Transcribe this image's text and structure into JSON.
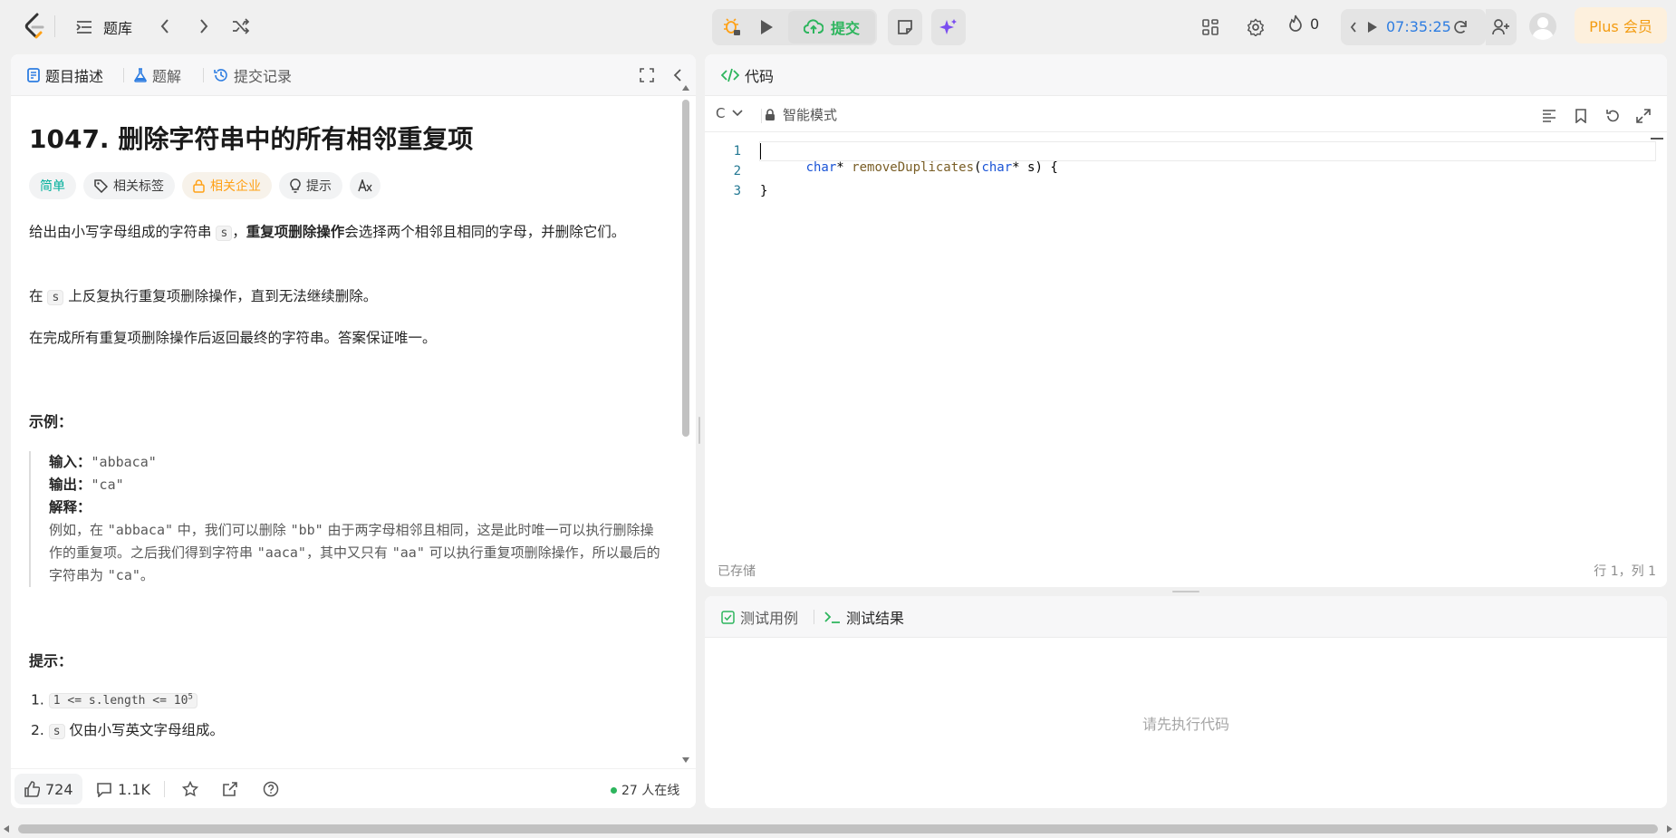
{
  "topbar": {
    "problem_list_label": "题库",
    "submit_label": "提交",
    "streak_count": "0",
    "timer": "07:35:25",
    "plus_label": "Plus 会员"
  },
  "left_panel": {
    "tabs": [
      "题目描述",
      "题解",
      "提交记录"
    ],
    "title": "1047. 删除字符串中的所有相邻重复项",
    "tags": {
      "difficulty": "简单",
      "related_tags": "相关标签",
      "related_companies": "相关企业",
      "hint": "提示"
    },
    "description": {
      "p1_part1": "给出由小写字母组成的字符串 ",
      "p1_code": "s",
      "p1_part2": "，",
      "p1_bold": "重复项删除操作",
      "p1_part3": "会选择两个相邻且相同的字母，并删除它们。",
      "p2_part1": "在 ",
      "p2_code": "s",
      "p2_part2": " 上反复执行重复项删除操作，直到无法继续删除。",
      "p3": "在完成所有重复项删除操作后返回最终的字符串。答案保证唯一。"
    },
    "example": {
      "heading": "示例：",
      "input_label": "输入：",
      "input_value": "\"abbaca\"",
      "output_label": "输出：",
      "output_value": "\"ca\"",
      "explain_label": "解释：",
      "explain_1": "例如，在 ",
      "explain_q1": "\"abbaca\"",
      "explain_2": " 中，我们可以删除 ",
      "explain_q2": "\"bb\"",
      "explain_3": " 由于两字母相邻且相同，这是此时唯一可以执行删除操作的重复项。之后我们得到字符串 ",
      "explain_q3": "\"aaca\"",
      "explain_4": "，其中又只有 ",
      "explain_q4": "\"aa\"",
      "explain_5": " 可以执行重复项删除操作，所以最后的字符串为 ",
      "explain_q5": "\"ca\"",
      "explain_6": "。"
    },
    "hints": {
      "heading": "提示：",
      "item1_num": "1.",
      "item1_code": "1 <= s.length <= 10",
      "item1_sup": "5",
      "item2_num": "2.",
      "item2_code": "s",
      "item2_text": " 仅由小写英文字母组成。"
    },
    "footer": {
      "likes": "724",
      "comments": "1.1K",
      "online": "27 人在线"
    }
  },
  "code_panel": {
    "tab_label": "代码",
    "language": "C",
    "mode_label": "智能模式",
    "line_numbers": [
      "1",
      "2",
      "3"
    ],
    "line1": {
      "kw1": "char",
      "t1": "* ",
      "fn": "removeDuplicates",
      "t2": "(",
      "kw2": "char",
      "t3": "* s) {"
    },
    "line3": "}",
    "saved_label": "已存储",
    "cursor_position": "行 1，列 1"
  },
  "test_panel": {
    "tab_cases": "测试用例",
    "tab_results": "测试结果",
    "placeholder": "请先执行代码"
  },
  "colors": {
    "easy": "#00af9b",
    "locked": "#ffa116",
    "submit": "#2db55d",
    "timer": "#2e7de1",
    "plus_bg": "#fdf0dd",
    "plus_text": "#f39c12"
  }
}
